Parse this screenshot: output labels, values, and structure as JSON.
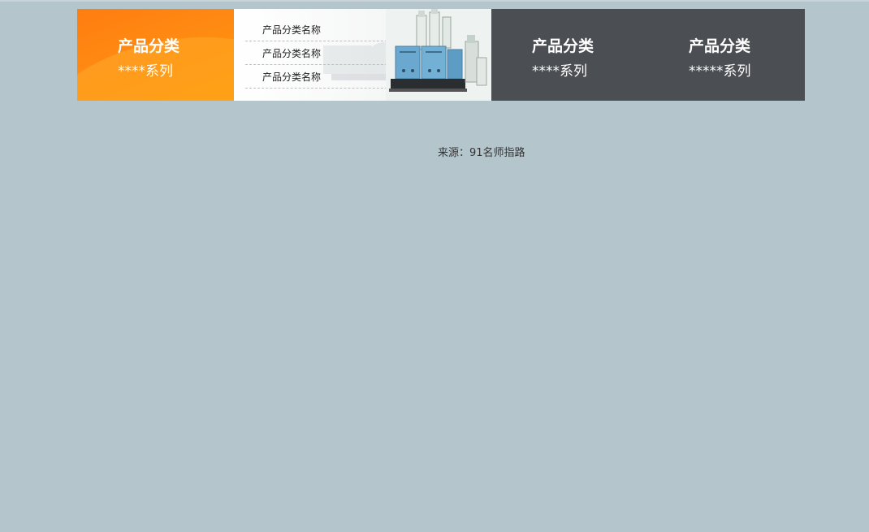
{
  "banner": {
    "category1": {
      "title": "产品分类",
      "subtitle": "****系列"
    },
    "list_items": [
      {
        "label": "产品分类名称"
      },
      {
        "label": "产品分类名称"
      },
      {
        "label": "产品分类名称"
      }
    ],
    "category2": {
      "title": "产品分类",
      "subtitle": "****系列"
    },
    "category3": {
      "title": "产品分类",
      "subtitle": "*****系列"
    }
  },
  "footer": {
    "source": "来源：91名师指路"
  },
  "colors": {
    "background": "#b4c5cc",
    "orange_accent": "#ff8a12",
    "dark_panel": "#4b4e52",
    "machine_blue": "#6aa8cf"
  },
  "icons": {
    "product_image": "extruder-machine-image"
  }
}
